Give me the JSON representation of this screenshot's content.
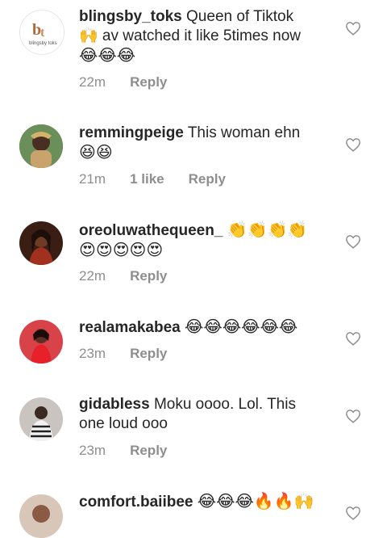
{
  "comments": [
    {
      "username": "blingsby_toks",
      "text": "Queen of Tiktok",
      "text2": "🙌 av watched it like 5times now",
      "emojis": "😂😂😂",
      "time": "22m",
      "likes": "",
      "reply": "Reply",
      "avatar_logo_text": "blingsby toks"
    },
    {
      "username": "remmingpeige",
      "text": "This woman ehn",
      "emojis": "😆😆",
      "time": "21m",
      "likes": "1 like",
      "reply": "Reply"
    },
    {
      "username": "oreoluwathequeen_",
      "text": "👏👏👏👏",
      "emojis": "😍😍😍😍😍",
      "time": "22m",
      "likes": "",
      "reply": "Reply"
    },
    {
      "username": "realamakabea",
      "text": "😂😂😂😂😂😂",
      "time": "23m",
      "likes": "",
      "reply": "Reply"
    },
    {
      "username": "gidabless",
      "text": "Moku oooo. Lol. This",
      "text2": "one loud ooo",
      "time": "23m",
      "likes": "",
      "reply": "Reply"
    },
    {
      "username": "comfort.baiibee",
      "text": "😂😂😂🔥🔥🙌"
    }
  ],
  "colors": {
    "text": "#262626",
    "meta": "#8e8e8e",
    "heart_stroke": "#8e8e8e"
  }
}
